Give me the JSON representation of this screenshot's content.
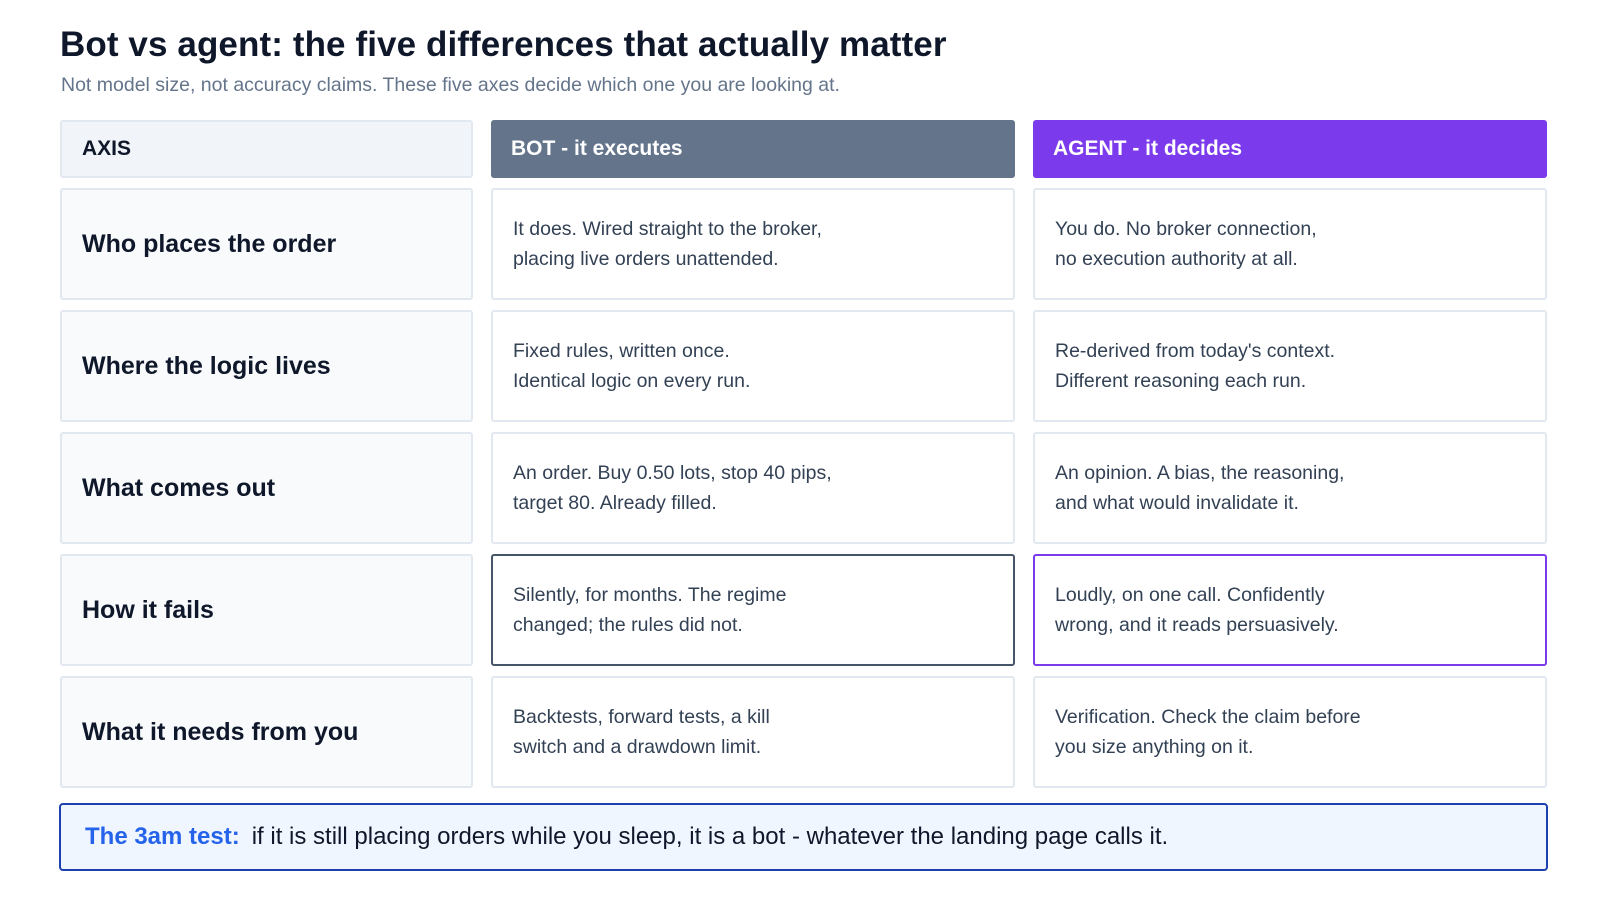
{
  "header": {
    "title": "Bot vs agent: the five differences that actually matter",
    "subtitle": "Not model size, not accuracy claims. These five axes decide which one you are looking at."
  },
  "columns": {
    "axis": "AXIS",
    "bot": "BOT - it executes",
    "agent": "AGENT - it decides"
  },
  "rows": [
    {
      "axis": "Who places the order",
      "bot": [
        "It does. Wired straight to the broker,",
        "placing live orders unattended."
      ],
      "agent": [
        "You do. No broker connection,",
        "no execution authority at all."
      ]
    },
    {
      "axis": "Where the logic lives",
      "bot": [
        "Fixed rules, written once.",
        "Identical logic on every run."
      ],
      "agent": [
        "Re-derived from today's context.",
        "Different reasoning each run."
      ]
    },
    {
      "axis": "What comes out",
      "bot": [
        "An order. Buy 0.50 lots, stop 40 pips,",
        "target 80. Already filled."
      ],
      "agent": [
        "An opinion. A bias, the reasoning,",
        "and what would invalidate it."
      ]
    },
    {
      "axis": "How it fails",
      "bot": [
        "Silently, for months. The regime",
        "changed; the rules did not."
      ],
      "agent": [
        "Loudly, on one call. Confidently",
        "wrong, and it reads persuasively."
      ]
    },
    {
      "axis": "What it needs from you",
      "bot": [
        "Backtests, forward tests, a kill",
        "switch and a drawdown limit."
      ],
      "agent": [
        "Verification. Check the claim before",
        "you size anything on it."
      ]
    }
  ],
  "callout": {
    "label": "The 3am test:",
    "text": "if it is still placing orders while you sleep, it is a bot - whatever the landing page calls it."
  },
  "colors": {
    "bot_header": "#64748b",
    "agent_header": "#7c3aed",
    "callout_accent": "#2563eb",
    "callout_border": "#1e40af"
  }
}
